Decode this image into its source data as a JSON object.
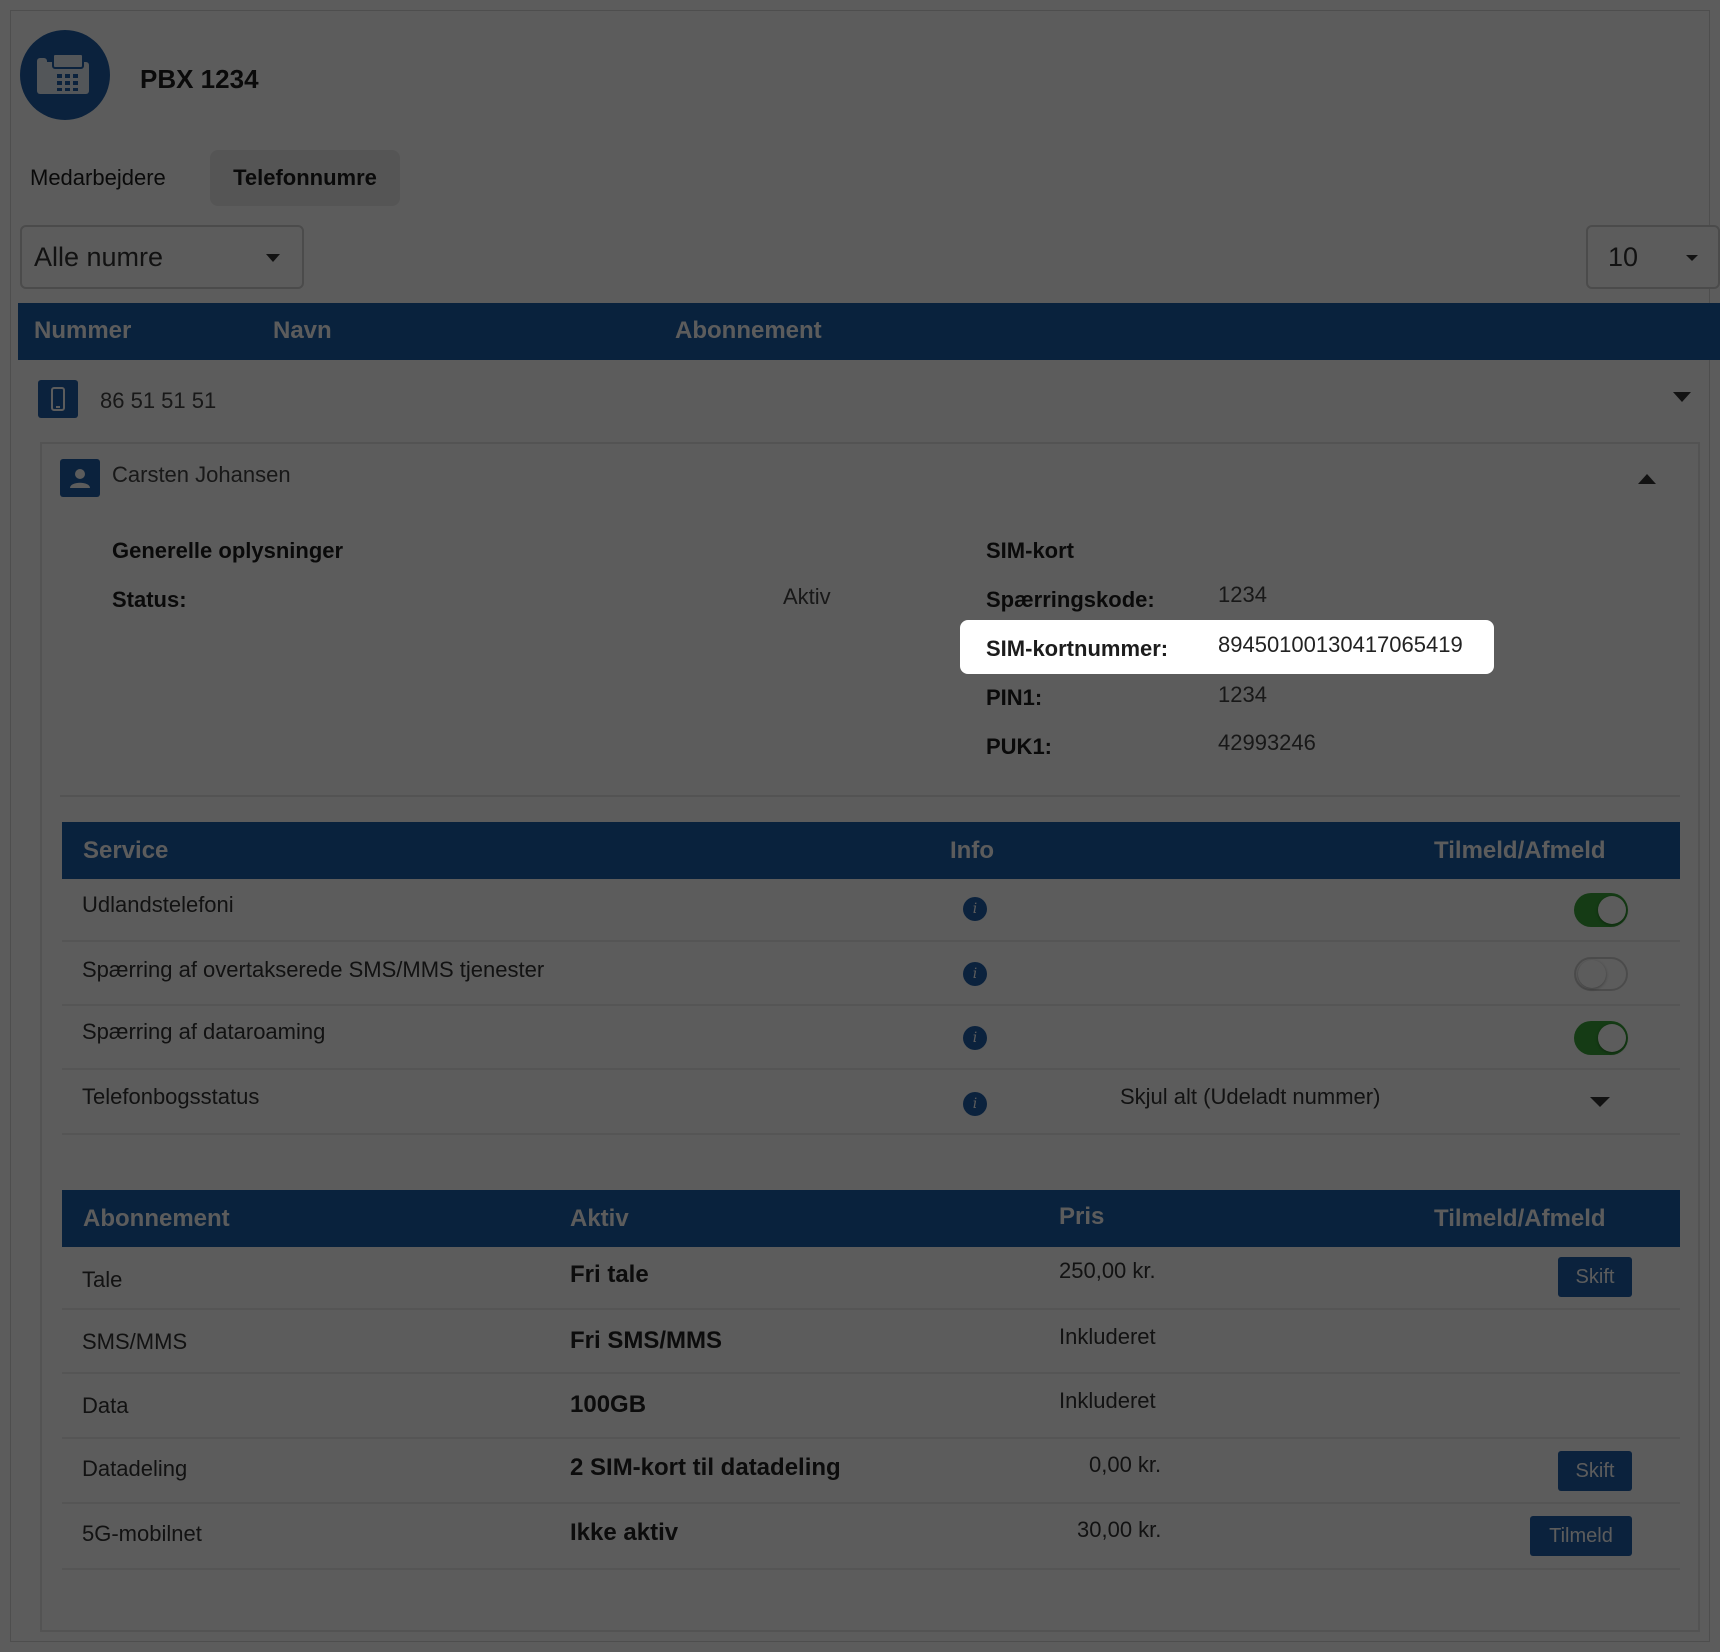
{
  "header": {
    "title": "PBX 1234",
    "logo_icon": "desk-phone-icon"
  },
  "tabs": [
    {
      "label": "Medarbejdere",
      "active": false
    },
    {
      "label": "Telefonnumre",
      "active": true
    }
  ],
  "filters": {
    "number_filter": "Alle numre",
    "page_size": "10"
  },
  "main_table": {
    "columns": [
      "Nummer",
      "Navn",
      "Abonnement"
    ],
    "row": {
      "number": "86 51 51 51",
      "icon": "mobile-phone-icon"
    }
  },
  "details": {
    "user_name": "Carsten Johansen",
    "general": {
      "heading": "Generelle oplysninger",
      "status_label": "Status:",
      "status_value": "Aktiv"
    },
    "sim": {
      "heading": "SIM-kort",
      "lock_code_label": "Spærringskode:",
      "lock_code_value": "1234",
      "sim_number_label": "SIM-kortnummer:",
      "sim_number_value": "8945010013041706541​9",
      "pin_label": "PIN1:",
      "pin_value": "1234",
      "puk_label": "PUK1:",
      "puk_value": "42993246"
    }
  },
  "services": {
    "columns": [
      "Service",
      "Info",
      "Tilmeld/Afmeld"
    ],
    "rows": [
      {
        "name": "Udlandstelefoni",
        "toggle_on": true
      },
      {
        "name": "Spærring af overtakserede SMS/MMS tjenester",
        "toggle_on": false
      },
      {
        "name": "Spærring af dataroaming",
        "toggle_on": true
      },
      {
        "name": "Telefonbogsstatus",
        "select_value": "Skjul alt (Udeladt nummer)"
      }
    ]
  },
  "subscriptions": {
    "columns": [
      "Abonnement",
      "Aktiv",
      "Pris",
      "Tilmeld/Afmeld"
    ],
    "rows": [
      {
        "name": "Tale",
        "active": "Fri tale",
        "price": "250,00 kr.",
        "action": "Skift"
      },
      {
        "name": "SMS/MMS",
        "active": "Fri SMS/MMS",
        "price": "Inkluderet",
        "action": ""
      },
      {
        "name": "Data",
        "active": "100GB",
        "price": "Inkluderet",
        "action": ""
      },
      {
        "name": "Datadeling",
        "active": "2 SIM-kort til datadeling",
        "price": "0,00 kr.",
        "action": "Skift"
      },
      {
        "name": "5G-mobilnet",
        "active": "Ikke aktiv",
        "price": "30,00 kr.",
        "action": "Tilmeld"
      }
    ]
  }
}
